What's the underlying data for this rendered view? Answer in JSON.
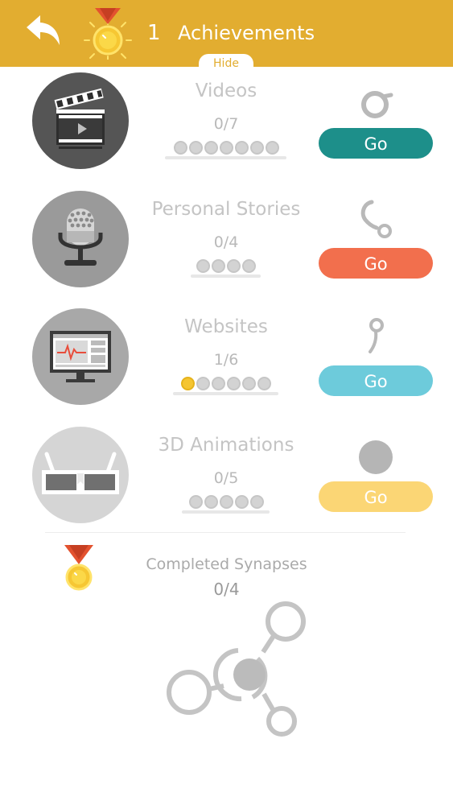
{
  "header": {
    "back_icon": "back-arrow-icon",
    "medal_icon": "medal-icon",
    "count": "1",
    "title": "Achievements",
    "hide_label": "Hide",
    "color": "#e2ad30"
  },
  "categories": [
    {
      "title": "Videos",
      "progress": "0/7",
      "completed": 0,
      "total": 7,
      "icon": "clapperboard-icon",
      "synapse_icon": "synapse-ring-icon",
      "go_label": "Go",
      "button_color": "#1d8f8a"
    },
    {
      "title": "Personal Stories",
      "progress": "0/4",
      "completed": 0,
      "total": 4,
      "icon": "microphone-icon",
      "synapse_icon": "synapse-hook-icon",
      "go_label": "Go",
      "button_color": "#f26f4d"
    },
    {
      "title": "Websites",
      "progress": "1/6",
      "completed": 1,
      "total": 6,
      "icon": "monitor-icon",
      "synapse_icon": "synapse-sprout-icon",
      "go_label": "Go",
      "button_color": "#6dcbdb"
    },
    {
      "title": "3D Animations",
      "progress": "0/5",
      "completed": 0,
      "total": 5,
      "icon": "3d-glasses-icon",
      "synapse_icon": "synapse-dot-icon",
      "go_label": "Go",
      "button_color": "#fbd675"
    }
  ],
  "completed": {
    "label": "Completed Synapses",
    "progress": "0/4",
    "icon": "medal-icon",
    "graph_icon": "synapse-network-icon"
  }
}
